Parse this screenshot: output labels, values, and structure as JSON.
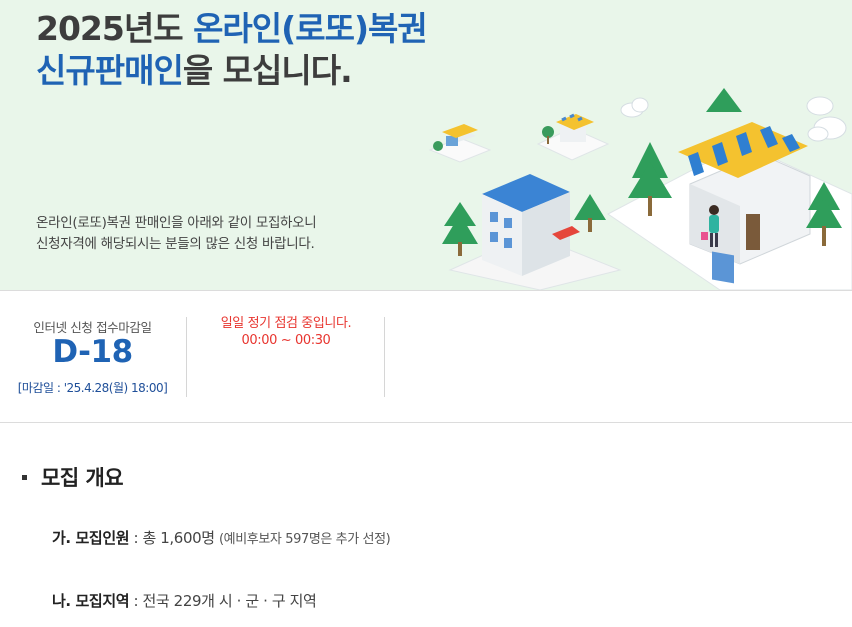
{
  "hero": {
    "title_line1_plain": "2025년도 ",
    "title_line1_blue": "온라인(로또)복권",
    "title_line2_blue": "신규판매인",
    "title_line2_plain": "을 모십니다.",
    "desc_line1": "온라인(로또)복권 판매인을 아래와 같이 모집하오니",
    "desc_line2": "신청자격에 해당되시는 분들의 많은 신청 바랍니다."
  },
  "status": {
    "deadline_label": "인터넷 신청 접수마감일",
    "dday": "D-18",
    "deadline_date": "[마감일 : '25.4.28(월) 18:00]",
    "notice_line1": "일일 정기 점검 중입니다.",
    "notice_line2": "00:00 ~ 00:30"
  },
  "overview": {
    "title": "모집 개요",
    "items": [
      {
        "label": "가. 모집인원",
        "sep": " : ",
        "value": "총 1,600명 ",
        "note": "(예비후보자 597명은 추가 선정)"
      },
      {
        "label": "나. 모집지역",
        "sep": " : ",
        "value": "전국 229개 시 · 군 · 구 지역",
        "note": ""
      }
    ]
  },
  "colors": {
    "accent_blue": "#1f63b4",
    "notice_red": "#e8352f",
    "hero_bg": "#e9f6ea"
  }
}
